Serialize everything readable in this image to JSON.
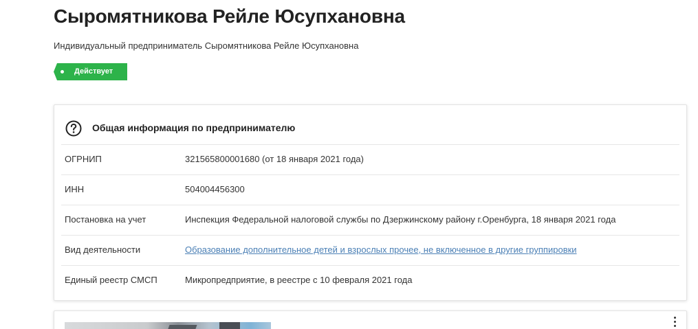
{
  "person": {
    "name": "Сыромятникова Рейле Юсупхановна",
    "full_title": "Индивидуальный предприниматель Сыромятникова Рейле Юсупхановна",
    "status": "Действует"
  },
  "colors": {
    "status_green": "#2db34a",
    "link_blue": "#4a7fb5"
  },
  "info_card": {
    "icon": "question-circle-icon",
    "title": "Общая информация по предпринимателю",
    "rows": [
      {
        "label": "ОГРНИП",
        "value": "321565800001680 (от 18 января 2021 года)"
      },
      {
        "label": "ИНН",
        "value": "504004456300"
      },
      {
        "label": "Постановка на учет",
        "value": "Инспекция Федеральной налоговой службы по Дзержинскому району г.Оренбурга, 18 января 2021 года"
      },
      {
        "label": "Вид деятельности",
        "value": "Образование дополнительное детей и взрослых прочее, не включенное в другие группировки"
      },
      {
        "label": "Единый реестр СМСП",
        "value": "Микропредприятие, в реестре с 10 февраля 2021 года"
      }
    ]
  },
  "second_card": {
    "menu_icon": "kebab-menu-icon"
  }
}
